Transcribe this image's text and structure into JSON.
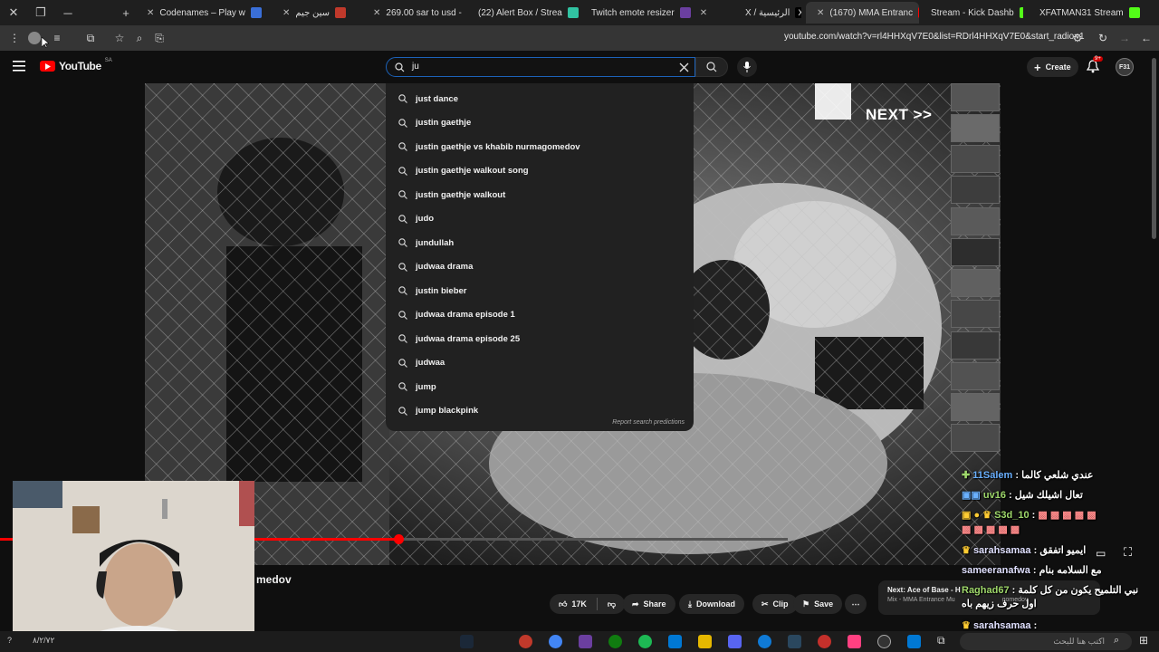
{
  "browser": {
    "tabs": [
      {
        "title": "Codenames – Play w",
        "active": false
      },
      {
        "title": "سين جيم",
        "active": false
      },
      {
        "title": "269.00 sar to usd - ",
        "active": false
      },
      {
        "title": "(22) Alert Box / Strea",
        "active": false
      },
      {
        "title": "Twitch emote resizer",
        "active": false
      },
      {
        "title": "X / الرئيسية",
        "active": false
      },
      {
        "title": "(1670) MMA Entranc",
        "active": true
      },
      {
        "title": "Stream - Kick Dashb",
        "active": false
      },
      {
        "title": "XFATMAN31 Stream",
        "active": false
      }
    ],
    "url": "youtube.com/watch?v=rl4HHXqV7E0&list=RDrl4HHXqV7E0&start_radio=1"
  },
  "youtube": {
    "logo_text": "YouTube",
    "region": "SA",
    "search_value": "ju",
    "create_label": "Create",
    "notif_badge": "9+",
    "avatar_text": "F31",
    "suggestions": [
      "just dance",
      "justin gaethje",
      "justin gaethje vs khabib nurmagomedov",
      "justin gaethje walkout song",
      "justin gaethje walkout",
      "judo",
      "jundullah",
      "judwaa drama",
      "justin bieber",
      "judwaa drama episode 1",
      "judwaa drama episode 25",
      "judwaa",
      "jump",
      "jump blackpink"
    ],
    "report_text": "Report search predictions",
    "video_overlay_text": "NEXT >>",
    "title_fragment": "medov",
    "actions": {
      "likes": "17K",
      "share": "Share",
      "download": "Download",
      "clip": "Clip",
      "save": "Save"
    },
    "next_up": {
      "line1": "Next: Ace of Base - H",
      "line2": "Mix - MMA Entrance Mu",
      "line2_tail": "gomedov"
    },
    "progress": 0.31
  },
  "chat": [
    {
      "user": "11Salem",
      "msg": ": عندي شلعي كالما"
    },
    {
      "user": "uv16",
      "msg": ": تعال اشيلك شيل"
    },
    {
      "user": "S3d_10",
      "msg": ":"
    },
    {
      "user": "sarahsamaa",
      "msg": ": ايميو اتفقق"
    },
    {
      "user": "sameeranafwa",
      "msg": ": مع السلامه بنام"
    },
    {
      "user": "Raghad67",
      "msg": ": نبي التلميح يكون من كل كلمة اول حرف زيهم باه"
    },
    {
      "user": "sarahsamaa",
      "msg": ":"
    }
  ],
  "taskbar": {
    "search_text": "اكتب هنا للبحث",
    "clock_fragment": "٨/٢/٧٢"
  },
  "colors": {
    "accent_blue": "#1c62b9",
    "youtube_red": "#ff0000",
    "chat_name": "#6ab0ff"
  }
}
